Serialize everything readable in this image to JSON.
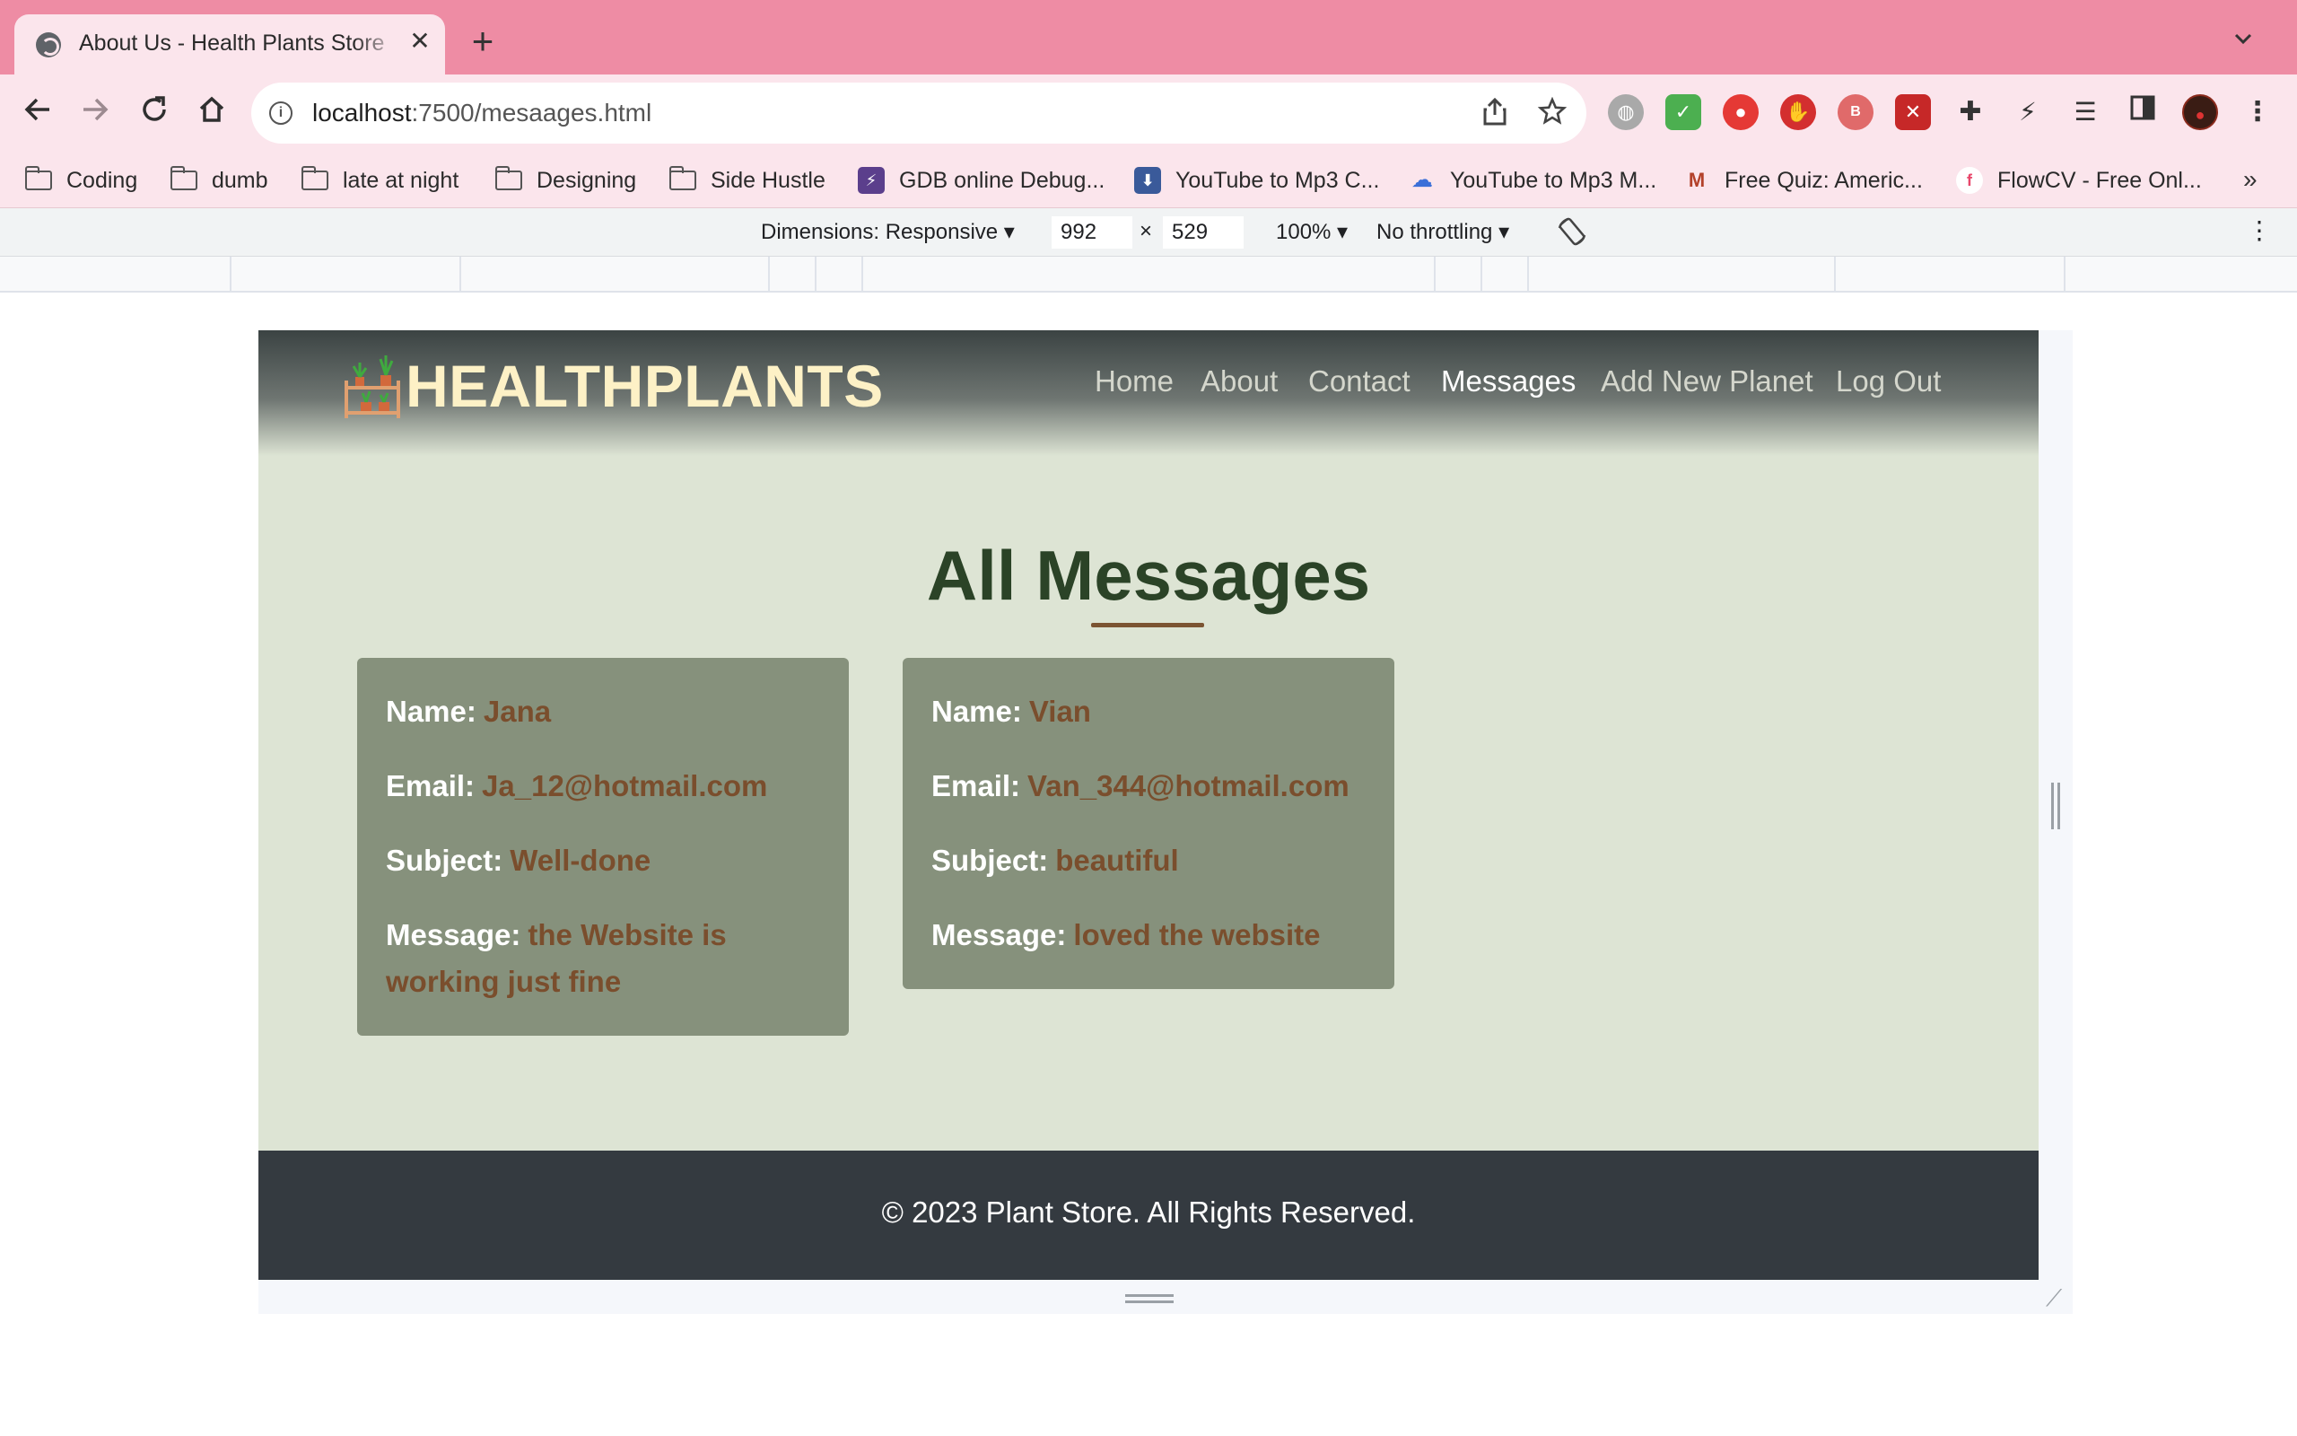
{
  "browser": {
    "tab_title": "About Us - Health Plants Store",
    "new_tab_symbol": "+",
    "close_symbol": "✕",
    "url_host": "localhost",
    "url_rest": ":7500/mesaages.html",
    "bookmarks": [
      {
        "label": "Coding",
        "icon": "folder-icon"
      },
      {
        "label": "dumb",
        "icon": "folder-icon"
      },
      {
        "label": "late at night",
        "icon": "folder-icon"
      },
      {
        "label": "Designing",
        "icon": "folder-icon"
      },
      {
        "label": "Side Hustle",
        "icon": "folder-icon"
      },
      {
        "label": "GDB online Debug...",
        "icon": "gdb-icon"
      },
      {
        "label": "YouTube to Mp3 C...",
        "icon": "download-icon"
      },
      {
        "label": "YouTube to Mp3 M...",
        "icon": "cloud-download-icon"
      },
      {
        "label": "Free Quiz: Americ...",
        "icon": "quiz-icon"
      },
      {
        "label": "FlowCV - Free Onl...",
        "icon": "flowcv-icon"
      }
    ],
    "bookmarks_more": "»"
  },
  "devtools": {
    "dimensions_label": "Dimensions: Responsive",
    "width": "992",
    "height": "529",
    "times": "×",
    "zoom": "100%",
    "throttling": "No throttling"
  },
  "site": {
    "logo_text": "HEALTHPLANTS",
    "nav": {
      "home": "Home",
      "about": "About",
      "contact": "Contact",
      "messages": "Messages",
      "add_new": "Add New Planet",
      "logout": "Log Out"
    },
    "section_title": "All Messages",
    "labels": {
      "name": "Name:",
      "email": "Email:",
      "subject": "Subject:",
      "message": "Message:"
    },
    "messages": [
      {
        "name": "Jana",
        "email": "Ja_12@hotmail.com",
        "subject": "Well-done",
        "message": "the Website is working just fine"
      },
      {
        "name": "Vian",
        "email": "Van_344@hotmail.com",
        "subject": "beautiful",
        "message": "loved the website"
      }
    ],
    "footer": "© 2023 Plant Store. All Rights Reserved."
  },
  "colors": {
    "tab_strip": "#ee8ca4",
    "toolbar": "#fbe5ec",
    "page_bg": "#dde4d4",
    "card_bg": "#86917c",
    "card_value": "#7a4e2d",
    "heading": "#2b4327",
    "underline": "#7b5432",
    "footer_bg": "#343a40",
    "logo_text": "#fdf1c6"
  }
}
